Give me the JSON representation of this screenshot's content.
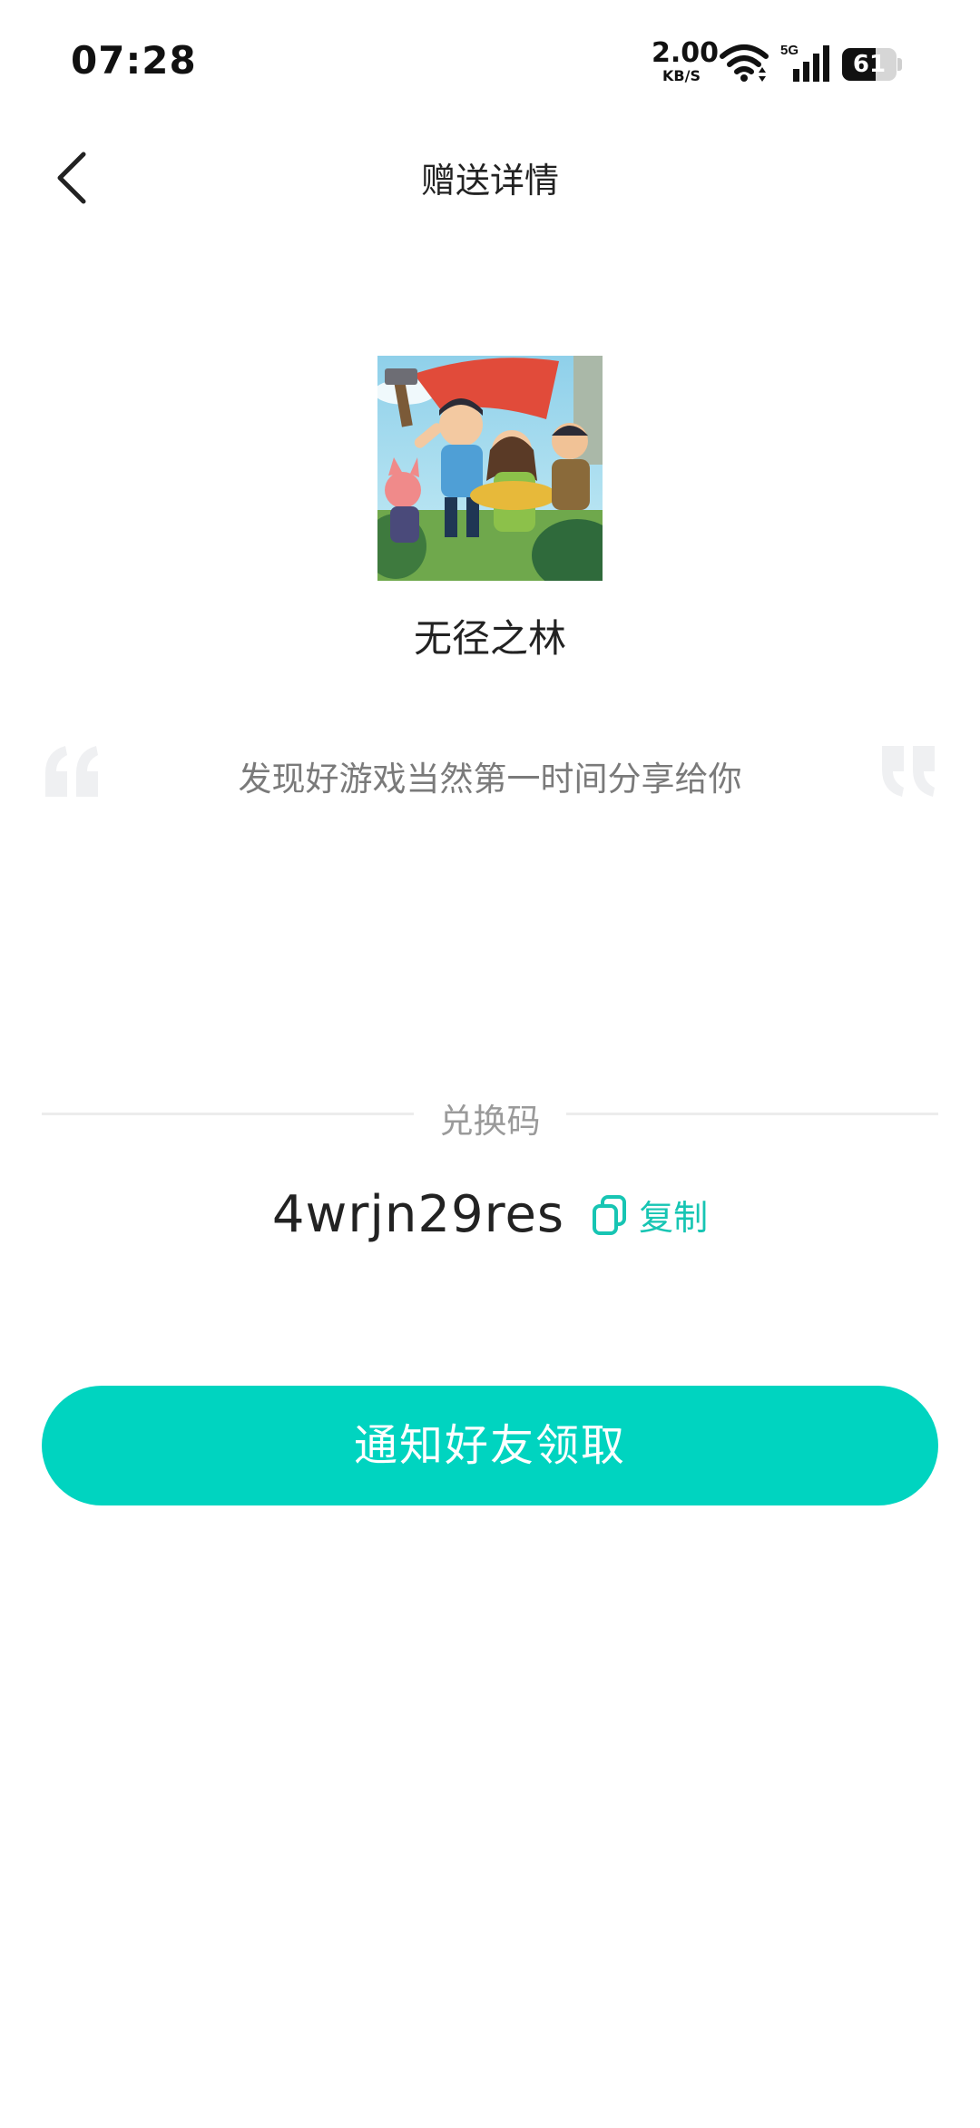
{
  "status_bar": {
    "time": "07:28",
    "net_speed_value": "2.00",
    "net_speed_unit": "KB/S",
    "network_type": "5G",
    "battery_level": "61",
    "battery_fraction": 0.61,
    "icons": [
      "wifi-icon",
      "cellular-signal-icon",
      "battery-icon"
    ]
  },
  "header": {
    "title": "赠送详情",
    "back_icon": "chevron-left-icon"
  },
  "game": {
    "name": "无径之林"
  },
  "message": {
    "text": "发现好游戏当然第一时间分享给你"
  },
  "redeem": {
    "label": "兑换码",
    "code": "4wrjn29res",
    "copy_label": "复制",
    "copy_icon": "copy-icon"
  },
  "actions": {
    "notify_label": "通知好友领取"
  },
  "colors": {
    "accent": "#00d4c0",
    "copy_text": "#17c5b3",
    "muted_text": "#7a7a7a",
    "divider": "#ececec"
  }
}
